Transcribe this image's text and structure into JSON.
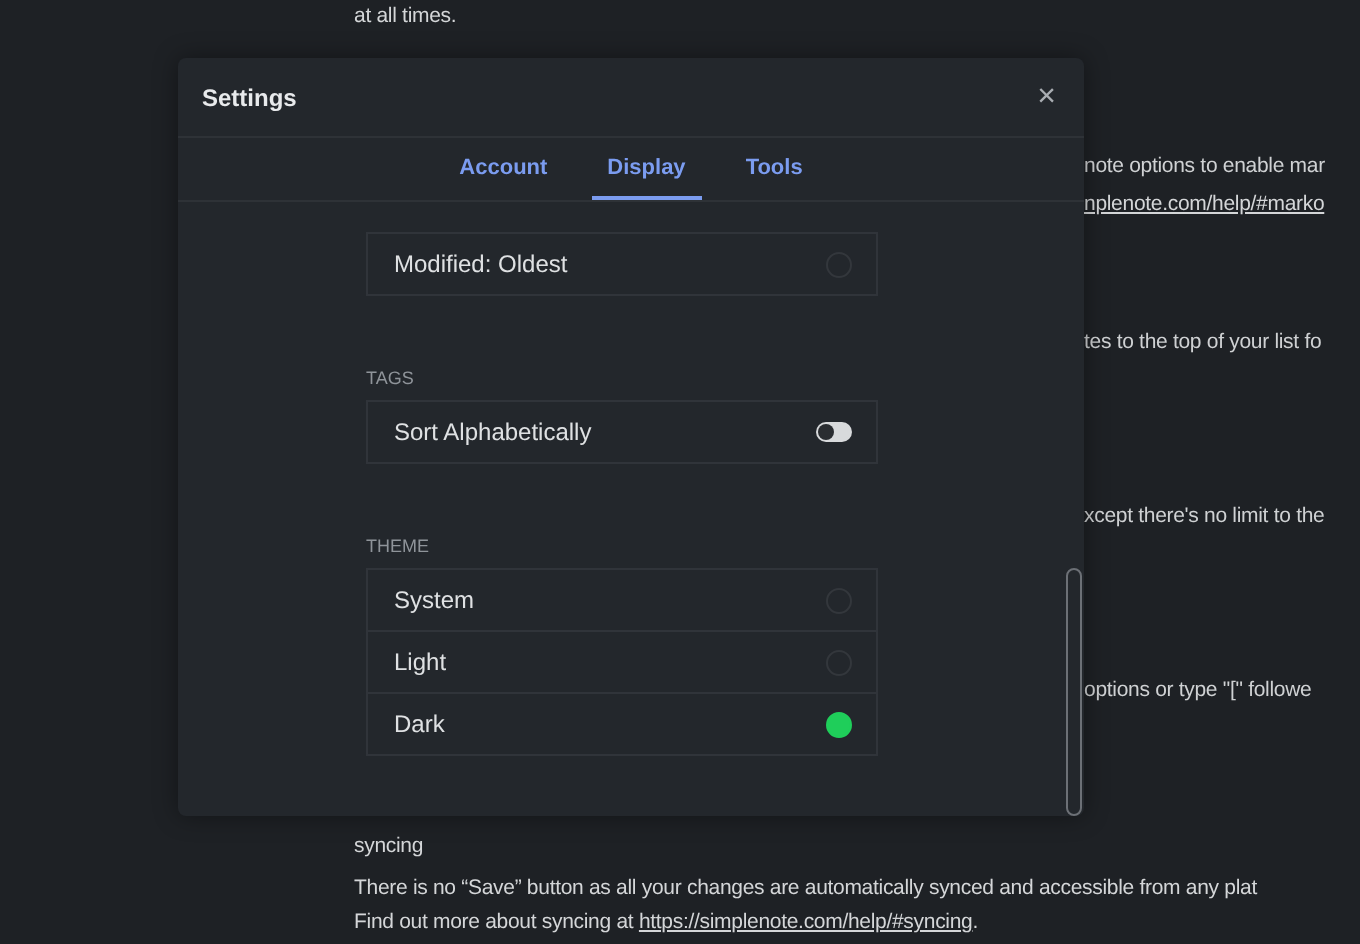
{
  "note": {
    "top_line": "at all times.",
    "fragments": [
      {
        "text": "note options to enable mar",
        "link": false
      },
      {
        "text": "nplenote.com/help/#marko",
        "link": true
      },
      {
        "text": "tes to the top of your list fo",
        "link": false
      },
      {
        "text": "xcept there's no limit to the",
        "link": false
      },
      {
        "text": "options or type \"[\" followe",
        "link": false
      }
    ],
    "heading": "syncing",
    "paragraph": "There is no “Save” button as all your changes are automatically synced and accessible from any plat",
    "last_line": "Find out more about syncing at",
    "last_link": "https://simplenote.com/help/#syncing",
    "last_end": "."
  },
  "dialog": {
    "title": "Settings",
    "close": "×",
    "tabs": [
      {
        "label": "Account",
        "selected": false
      },
      {
        "label": "Display",
        "selected": true
      },
      {
        "label": "Tools",
        "selected": false
      }
    ],
    "sections": [
      {
        "items": [
          {
            "kind": "radio",
            "label": "Modified: Oldest",
            "on": false
          }
        ]
      },
      {
        "heading": "TAGS",
        "items": [
          {
            "kind": "toggle",
            "label": "Sort Alphabetically",
            "on": false
          }
        ]
      },
      {
        "heading": "THEME",
        "items": [
          {
            "kind": "radio",
            "label": "System",
            "on": false
          },
          {
            "kind": "radio",
            "label": "Light",
            "on": false
          },
          {
            "kind": "radio",
            "label": "Dark",
            "on": true
          }
        ]
      }
    ]
  }
}
